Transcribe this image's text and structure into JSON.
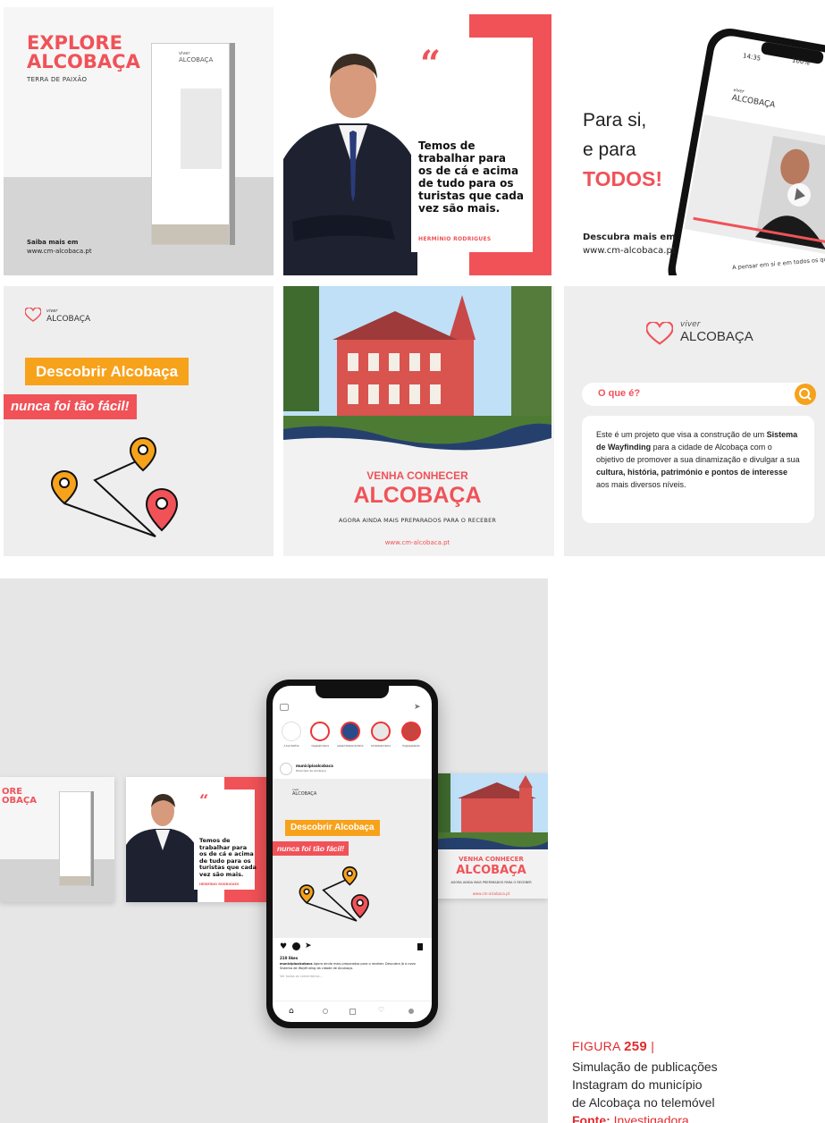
{
  "tile1": {
    "title_line1": "EXPLORE",
    "title_line2": "ALCOBAÇA",
    "subtitle": "TERRA DE PAIXÃO",
    "totem_logo_small": "viver",
    "totem_logo": "ALCOBAÇA",
    "footer_line1": "Saiba mais em",
    "footer_line2": "www.cm-alcobaca.pt"
  },
  "tile2": {
    "quote_mark": "“",
    "quote_line1": "Temos de",
    "quote_line2": "trabalhar para",
    "quote_line3": "os de cá e acima",
    "quote_line4": "de tudo para os",
    "quote_line5": "turistas que cada",
    "quote_line6": "vez são mais.",
    "author": "HERMÍNIO RODRIGUES"
  },
  "tile3": {
    "line1": "Para si,",
    "line2": "e para",
    "line3": "TODOS!",
    "more_line1": "Descubra mais em",
    "more_line2": "www.cm-alcobaca.pt",
    "phone_time": "14:35",
    "phone_battery": "100%",
    "logo_small": "viver",
    "logo": "ALCOBAÇA",
    "caption": "A pensar em si e em todos os que pre"
  },
  "tile4": {
    "logo_small": "viver",
    "logo": "ALCOBAÇA",
    "banner1": "Descobrir Alcobaça",
    "banner2": "nunca foi tão fácil!"
  },
  "tile5": {
    "heading1": "VENHA CONHECER",
    "heading2": "ALCOBAÇA",
    "tagline": "AGORA AINDA MAIS PREPARADOS PARA O RECEBER",
    "url": "www.cm-alcobaca.pt"
  },
  "tile6": {
    "logo_small": "viver",
    "logo": "ALCOBAÇA",
    "search_label": "O que é?",
    "text_a": "Este é um projeto que visa a construção de um ",
    "text_b": "Sistema de Wayfinding",
    "text_c": " para a cidade de Alcobaça com o objetivo de promover a sua dinamização e divulgar a sua ",
    "text_d": "cultura, história, património e pontos de interesse",
    "text_e": " aos mais diversos níveis."
  },
  "mockup": {
    "left_title1": "ORE",
    "left_title2": "OBAÇA",
    "quote_mark": "“",
    "quote_line1": "Temos de",
    "quote_line2": "trabalhar para",
    "quote_line3": "os de cá e acima",
    "quote_line4": "de tudo para os",
    "quote_line5": "turistas que cada",
    "quote_line6": "vez são mais.",
    "quote_author": "HERMÍNIO RODRIGUES",
    "right_h1": "VENHA CONHECER",
    "right_h2": "ALCOBAÇA",
    "right_tag": "AGORA AINDA MAIS PREPARADOS PARA O RECEBER",
    "right_url": "www.cm-alcobaca.pt",
    "phone": {
      "stories": [
        "A tua história",
        "megaaalcobaca",
        "pelascidadesvoluntaria",
        "terrasdealcobaca",
        "freguesiadevila"
      ],
      "account": "municipioalcobaca",
      "account_sub": "Município de Alcobaça",
      "post_logo_small": "viver",
      "post_logo": "ALCOBAÇA",
      "post_banner1": "Descobrir Alcobaça",
      "post_banner2": "nunca foi tão fácil!",
      "likes": "210 likes",
      "caption_user": "municipioalcobaca",
      "caption_text": "Agora ainda mais preparados para o receber. Descubra já o novo Sistema de Wayfinding da cidade de Alcobaça.",
      "comments": "Ver todos os comentários..."
    }
  },
  "caption": {
    "figure_label": "FIGURA ",
    "figure_number": "259",
    "figure_sep": " |",
    "line1": "Simulação de publicações",
    "line2": "Instagram do município",
    "line3": "de Alcobaça no telemóvel",
    "source_label": "Fonte:",
    "source_text": " Investigadora"
  },
  "colors": {
    "accent_red": "#f05258",
    "accent_orange": "#f7a21b",
    "caption_red": "#e02b2f"
  }
}
